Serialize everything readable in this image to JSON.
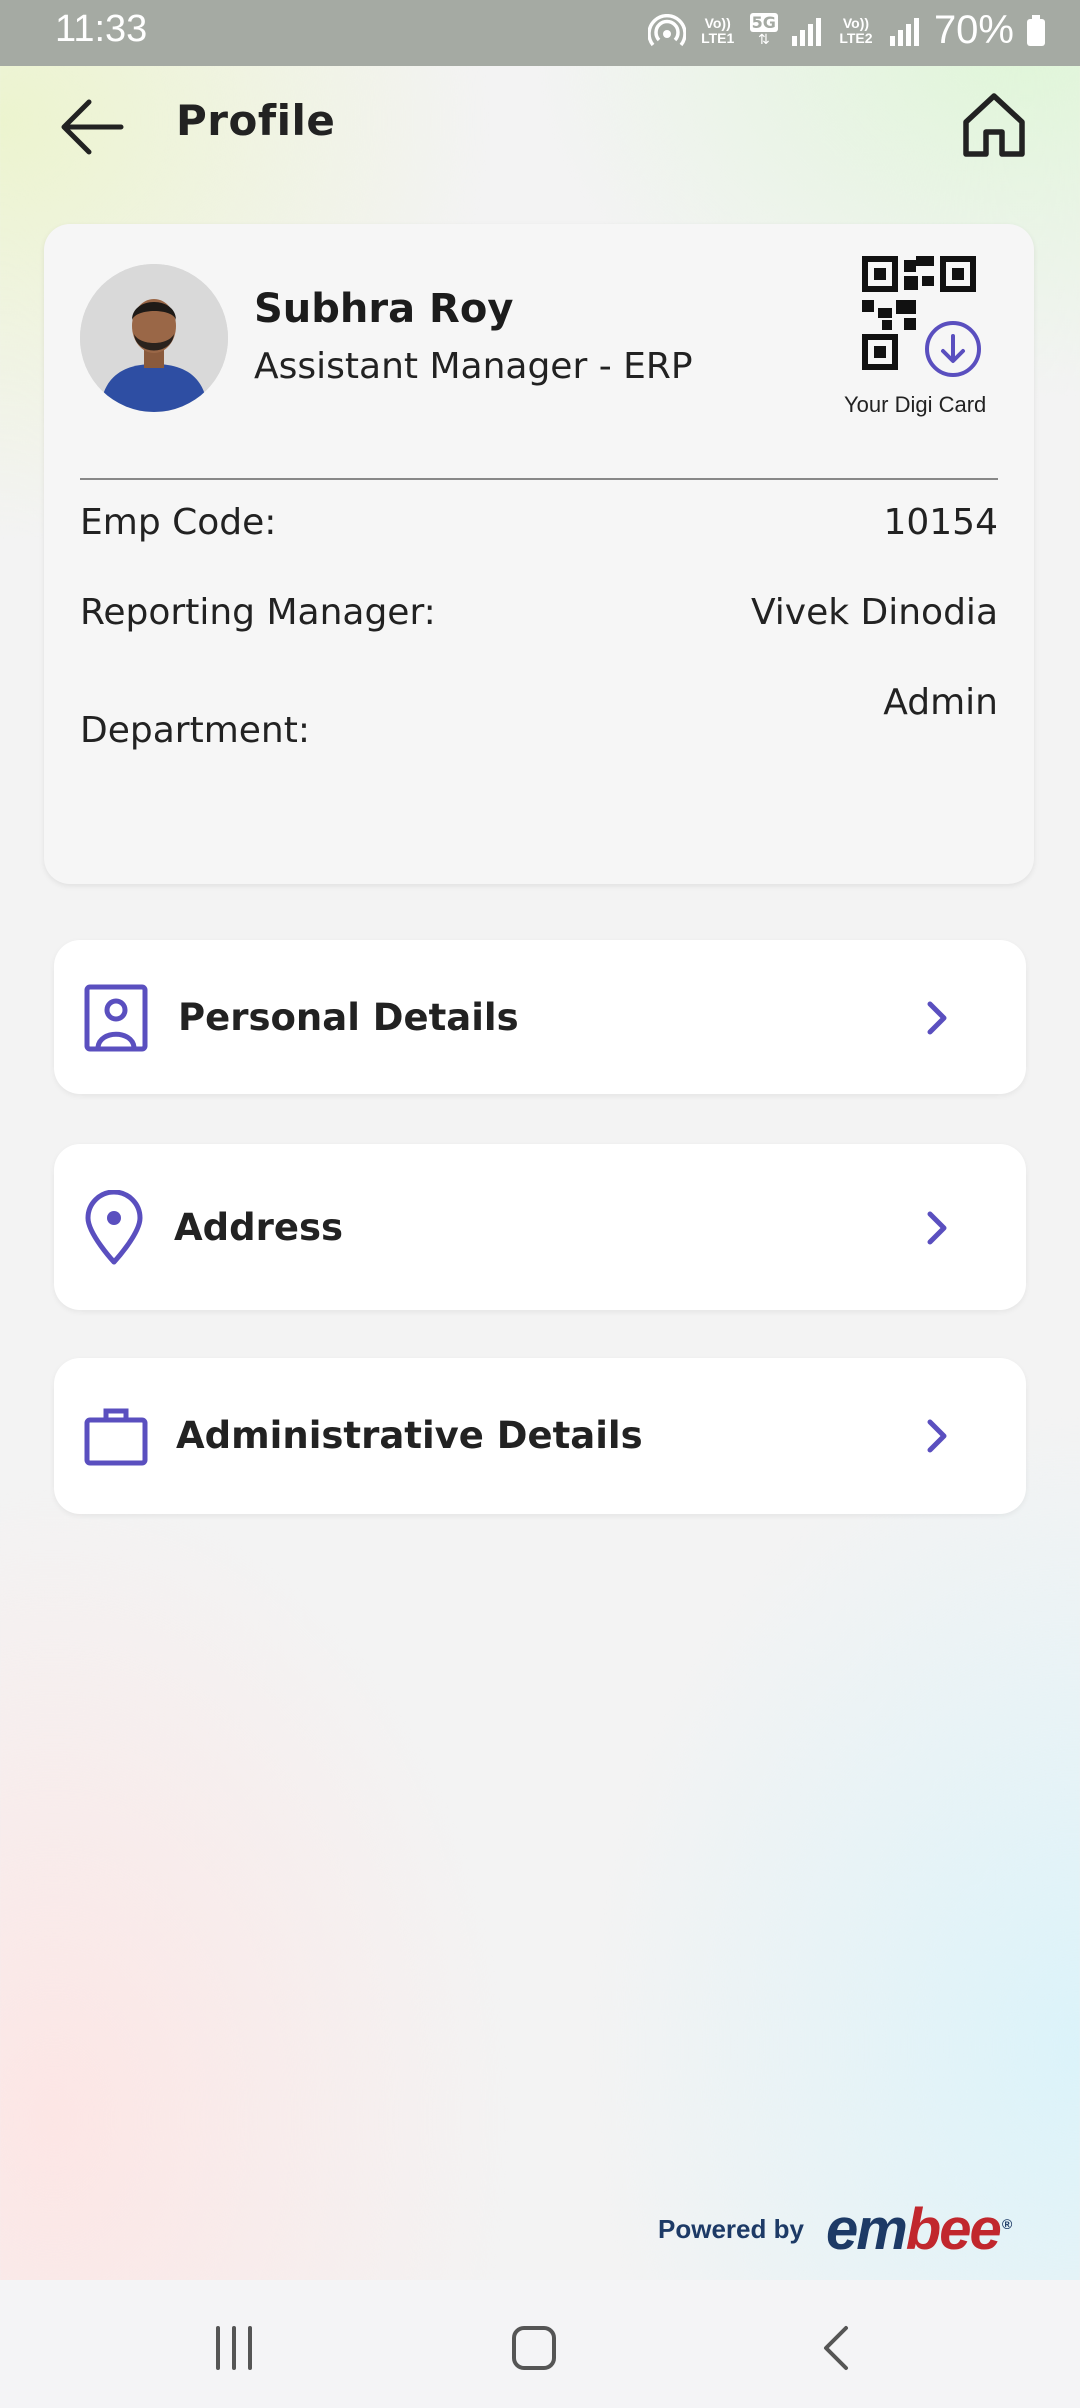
{
  "status_bar": {
    "time": "11:33",
    "lte1": "Vo)) LTE1",
    "lte2": "Vo)) LTE2",
    "network": "5G",
    "battery": "70%"
  },
  "header": {
    "title": "Profile"
  },
  "profile": {
    "name": "Subhra Roy",
    "role": "Assistant Manager - ERP",
    "digi_card_label": "Your Digi Card",
    "fields": {
      "emp_code_label": "Emp Code:",
      "emp_code_value": "10154",
      "manager_label": "Reporting Manager:",
      "manager_value": "Vivek Dinodia",
      "department_label": "Department:",
      "department_value": "Admin"
    }
  },
  "menu": {
    "personal": "Personal Details",
    "address": "Address",
    "administrative": "Administrative Details"
  },
  "footer": {
    "powered_by": "Powered by",
    "brand_part1": "em",
    "brand_part2": "bee",
    "brand_mark": "®"
  },
  "colors": {
    "accent": "#5a4fbf",
    "brand_blue": "#1d3a66",
    "brand_red": "#c1272d"
  },
  "icons": {
    "back": "arrow-left-icon",
    "home": "home-icon",
    "personal": "id-card-icon",
    "address": "map-pin-icon",
    "administrative": "briefcase-icon",
    "chevron": "chevron-right-icon",
    "qr": "qr-code-icon",
    "download": "download-icon"
  }
}
